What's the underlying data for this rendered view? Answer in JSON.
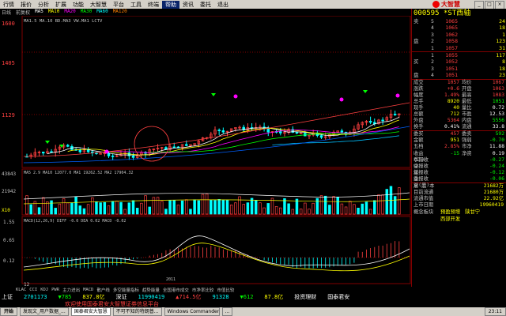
{
  "menu": [
    "行情",
    "报价",
    "分析",
    "扩展",
    "功能",
    "大智慧",
    "平台",
    "工具",
    "终端",
    "帮助",
    "资讯",
    "委托",
    "退出"
  ],
  "menu_active": "帮助",
  "brand": "大智慧",
  "toolbar": [
    "日线",
    "前复权",
    "MA5",
    "MA10",
    "MA20",
    "MA30",
    "MA60",
    "MA120"
  ],
  "chart": {
    "price_axis": [
      "1600",
      "1405",
      "1129"
    ],
    "ma_line": "MA1.5 MA.10 BD.MA3 VW.MA1 LCTV",
    "ma_values": "MA5 2.9 MA10 12077.0 MA1 19262.52 MA2 17904.32",
    "vol_axis": [
      "43843",
      "21942",
      "X10"
    ],
    "macd_label": "MACD(12,26,9) DIFF -0.0 DEA 0.02 MACD -0.02",
    "macd_axis": [
      "1.55",
      "0.65",
      "0.12"
    ],
    "date_label": "12",
    "date_mid": "2011"
  },
  "quote": {
    "code": "000595",
    "name": "*ST西轴",
    "sell": [
      {
        "label": "卖",
        "idx": "5",
        "price": "1065",
        "vol": "24"
      },
      {
        "label": "",
        "idx": "4",
        "price": "1065",
        "vol": "18"
      },
      {
        "label": "",
        "idx": "3",
        "price": "1062",
        "vol": "1"
      },
      {
        "label": "盘",
        "idx": "2",
        "price": "1058",
        "vol": "123"
      },
      {
        "label": "",
        "idx": "1",
        "price": "1057",
        "vol": "31"
      }
    ],
    "buy": [
      {
        "label": "",
        "idx": "1",
        "price": "1055",
        "vol": "117"
      },
      {
        "label": "买",
        "idx": "2",
        "price": "1052",
        "vol": "8"
      },
      {
        "label": "",
        "idx": "3",
        "price": "1051",
        "vol": "18"
      },
      {
        "label": "盘",
        "idx": "4",
        "price": "1051",
        "vol": "23"
      }
    ],
    "info": [
      {
        "k1": "成交",
        "v1": "1057",
        "c1": "red",
        "k2": "均价",
        "v2": "1067",
        "c2": "red"
      },
      {
        "k1": "涨跌",
        "v1": "+0.6",
        "c1": "red",
        "k2": "开盘",
        "v2": "1063",
        "c2": "red"
      },
      {
        "k1": "幅度",
        "v1": "1.49%",
        "c1": "red",
        "k2": "最高",
        "v2": "1083",
        "c2": "red"
      },
      {
        "k1": "总手",
        "v1": "8920",
        "c1": "yellow",
        "k2": "最低",
        "v2": "1051",
        "c2": "green"
      },
      {
        "k1": "现手",
        "v1": "40",
        "c1": "yellow",
        "k2": "量比",
        "v2": "0.72",
        "c2": "white"
      },
      {
        "k1": "总额",
        "v1": "712",
        "c1": "yellow",
        "k2": "市盈",
        "v2": "12.53",
        "c2": "white"
      },
      {
        "k1": "外盘",
        "v1": "5364",
        "c1": "red",
        "k2": "内盘",
        "v2": "5556",
        "c2": "green"
      },
      {
        "k1": "换手",
        "v1": "0.41%",
        "c1": "white",
        "k2": "流通",
        "v2": "33.8",
        "c2": "white"
      }
    ],
    "info2": [
      {
        "k1": "委买",
        "v1": "457",
        "c1": "red",
        "k2": "委卖",
        "v2": "592",
        "c2": "green"
      },
      {
        "k1": "金额",
        "v1": "951",
        "c1": "yellow",
        "k2": "强弱",
        "v2": "-0.70",
        "c2": "green"
      },
      {
        "k1": "五档",
        "v1": "2.85%",
        "c1": "red",
        "k2": "市净",
        "v2": "11.88",
        "c2": "white"
      },
      {
        "k1": "收益(二)",
        "v1": "-15",
        "c1": "green",
        "k2": "净资",
        "v2": "0.19",
        "c2": "white"
      },
      {
        "k1": "季报收益",
        "v1": "",
        "c1": "white",
        "k2": "",
        "v2": "-0.27",
        "c2": "green"
      },
      {
        "k1": "中报收益",
        "v1": "",
        "c1": "white",
        "k2": "",
        "v2": "-0.24",
        "c2": "green"
      },
      {
        "k1": "年报收益",
        "v1": "",
        "c1": "white",
        "k2": "",
        "v2": "-0.12",
        "c2": "green"
      },
      {
        "k1": "季报收益(三)",
        "v1": "",
        "c1": "white",
        "k2": "",
        "v2": "-0.06",
        "c2": "green"
      }
    ],
    "capital": [
      {
        "k": "总 股 本",
        "v": "21682万"
      },
      {
        "k": "目前流通",
        "v": "21680万"
      },
      {
        "k": "流通市值",
        "v": "22.92亿"
      },
      {
        "k": "上市日期",
        "v": "19960419"
      }
    ],
    "concept_label": "概念板块",
    "concepts": [
      "预盈预增",
      "陕甘宁",
      "西部开发"
    ]
  },
  "tabs": [
    "KLAC",
    "CCI",
    "KDJ",
    "PWR",
    "主力进出",
    "MACD",
    "散户线",
    "多空能量指标",
    "趋势能量",
    "全国港市成交",
    "市净率比较",
    "市值比较"
  ],
  "ticker": {
    "row1": [
      {
        "t": "上证",
        "c": "white"
      },
      {
        "t": "2701173",
        "c": "cyan"
      },
      {
        "t": "▼785",
        "c": "green"
      },
      {
        "t": "837.8亿",
        "c": "yellow"
      },
      {
        "t": "深证",
        "c": "white"
      },
      {
        "t": "11990419",
        "c": "cyan"
      },
      {
        "t": "▲714.5亿",
        "c": "red"
      },
      {
        "t": "91328",
        "c": "cyan"
      },
      {
        "t": "▼612",
        "c": "green"
      },
      {
        "t": "87.8亿",
        "c": "yellow"
      },
      {
        "t": "投资理财",
        "c": "white"
      },
      {
        "t": "国泰君安",
        "c": "white"
      }
    ],
    "row2": "欢迎使用国泰君安大智慧证券信息平台"
  },
  "taskbar": {
    "start": "开始",
    "tasks": [
      "发现文_用户数据_...",
      "国泰君安大智慧",
      "不可不知的特朗普...",
      "Windows Commander 5",
      "..."
    ],
    "clock": "23:11"
  }
}
